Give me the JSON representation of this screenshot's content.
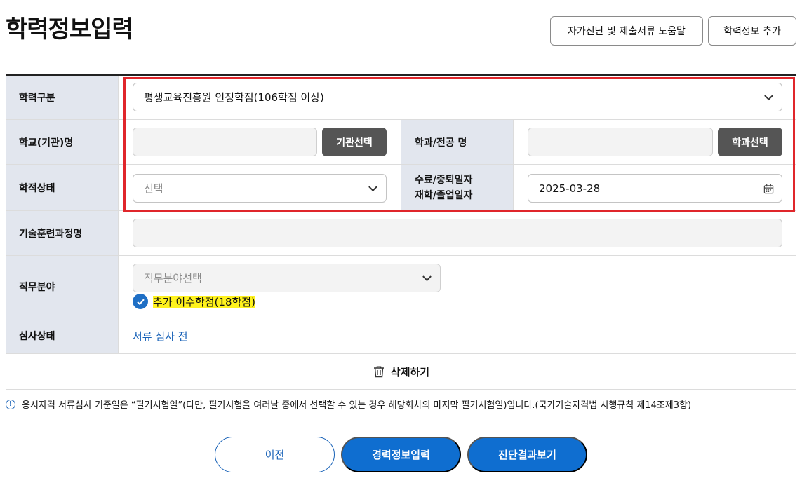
{
  "page": {
    "title": "학력정보입력"
  },
  "top_buttons": {
    "help": "자가진단 및 제출서류 도움말",
    "add": "학력정보 추가"
  },
  "form": {
    "education_type": {
      "label": "학력구분",
      "value": "평생교육진흥원 인정학점(106학점 이상)"
    },
    "school": {
      "label": "학교(기관)명",
      "value": "",
      "button": "기관선택"
    },
    "major": {
      "label": "학과/전공 명",
      "value": "",
      "button": "학과선택"
    },
    "status": {
      "label": "학적상태",
      "placeholder": "선택"
    },
    "date": {
      "label_line1": "수료/중퇴일자",
      "label_line2": "재학/졸업일자",
      "value": "2025-03-28"
    },
    "training": {
      "label": "기술훈련과정명",
      "value": ""
    },
    "job_field": {
      "label": "직무분야",
      "placeholder": "직무분야선택",
      "checkbox_label": "추가 이수학점(18학점)",
      "checked": true
    },
    "review": {
      "label": "심사상태",
      "value": "서류 심사 전"
    }
  },
  "delete_label": "삭제하기",
  "notice": "응시자격 서류심사 기준일은 “필기시험일”(다만, 필기시험을 여러날 중에서 선택할 수 있는 경우 해당회차의 마지막 필기시험일)입니다.(국가기술자격법 시행규칙 제14조제3항)",
  "bottom_buttons": {
    "prev": "이전",
    "career": "경력정보입력",
    "result": "진단결과보기"
  },
  "colors": {
    "primary": "#0f6ed0",
    "highlight_box": "#e0262b",
    "label_bg": "#e2e6ee",
    "text_highlight": "#fff21d"
  },
  "icons": [
    "chevron-down-icon",
    "calendar-icon",
    "check-icon",
    "trash-icon",
    "info-icon"
  ]
}
